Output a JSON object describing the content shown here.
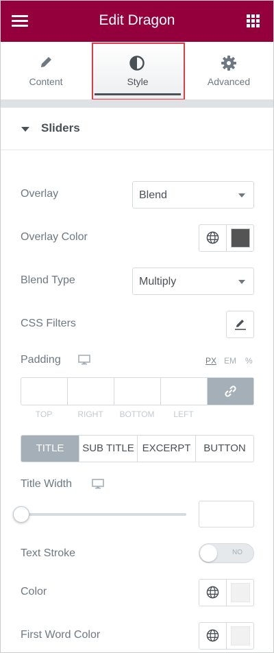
{
  "header": {
    "title": "Edit Dragon",
    "menu_icon": "hamburger-icon",
    "apps_icon": "grid-icon"
  },
  "tabs": [
    {
      "label": "Content",
      "icon": "pencil-icon"
    },
    {
      "label": "Style",
      "icon": "half-circle-icon",
      "active": true
    },
    {
      "label": "Advanced",
      "icon": "gear-icon"
    }
  ],
  "section": {
    "title": "Sliders"
  },
  "controls": {
    "overlay": {
      "label": "Overlay",
      "value": "Blend"
    },
    "overlay_color": {
      "label": "Overlay Color",
      "color": "#545454"
    },
    "blend_type": {
      "label": "Blend Type",
      "value": "Multiply"
    },
    "css_filters": {
      "label": "CSS Filters"
    },
    "padding": {
      "label": "Padding",
      "units": [
        "PX",
        "EM",
        "%"
      ],
      "active_unit": "PX",
      "sides": [
        "TOP",
        "RIGHT",
        "BOTTOM",
        "LEFT"
      ]
    },
    "style_tabs": {
      "items": [
        "TITLE",
        "SUB TITLE",
        "EXCERPT",
        "BUTTON"
      ],
      "active": "TITLE"
    },
    "title_width": {
      "label": "Title Width",
      "slider_fraction": 0
    },
    "text_stroke": {
      "label": "Text Stroke",
      "state": "NO"
    },
    "color": {
      "label": "Color",
      "color": "#f1f1f1"
    },
    "first_word_color": {
      "label": "First Word Color",
      "color": "#f1f1f1"
    }
  },
  "colors": {
    "header_bg": "#93003c",
    "highlight": "#e03a48",
    "accent_gray": "#a4afb7"
  }
}
